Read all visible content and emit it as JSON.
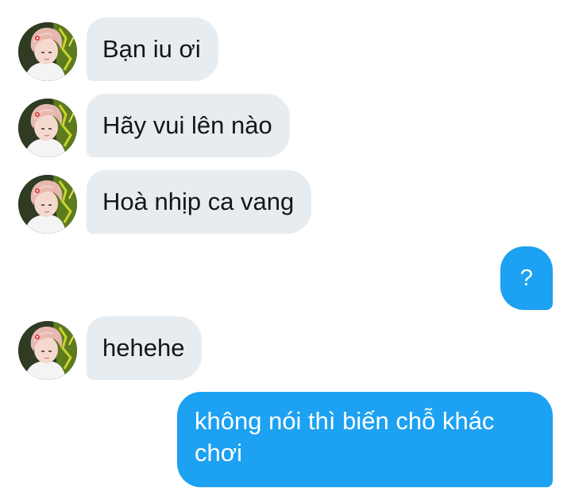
{
  "conversation": {
    "messages": [
      {
        "direction": "incoming",
        "text": "Bạn iu ơi"
      },
      {
        "direction": "incoming",
        "text": "Hãy vui lên nào"
      },
      {
        "direction": "incoming",
        "text": "Hoà nhịp ca vang"
      },
      {
        "direction": "outgoing",
        "text": "?"
      },
      {
        "direction": "incoming",
        "text": "hehehe"
      },
      {
        "direction": "outgoing",
        "text": "không nói thì biến chỗ khác chơi"
      }
    ]
  },
  "colors": {
    "incoming_bubble": "#e6ecf0",
    "incoming_text": "#14171a",
    "outgoing_bubble": "#1da1f2",
    "outgoing_text": "#ffffff",
    "background": "#ffffff"
  },
  "icons": {
    "avatar": "user-avatar-photo"
  }
}
